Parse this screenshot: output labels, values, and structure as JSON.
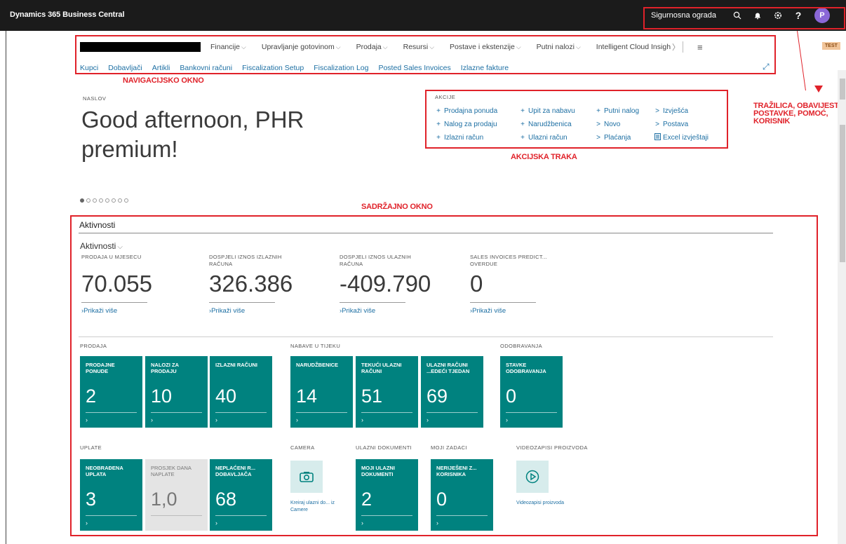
{
  "topbar": {
    "app_title": "Dynamics 365 Business Central",
    "environment": "Sigurnosna ograda",
    "avatar_initial": "P"
  },
  "nav": {
    "menus": [
      {
        "label": "Financije"
      },
      {
        "label": "Upravljanje gotovinom"
      },
      {
        "label": "Prodaja"
      },
      {
        "label": "Resursi"
      },
      {
        "label": "Postave i ekstenzije"
      },
      {
        "label": "Putni nalozi"
      },
      {
        "label": "Intelligent Cloud Insigh"
      }
    ],
    "links": [
      "Kupci",
      "Dobavljači",
      "Artikli",
      "Bankovni računi",
      "Fiscalization Setup",
      "Fiscalization Log",
      "Posted Sales Invoices",
      "Izlazne fakture"
    ],
    "badge": "TEST"
  },
  "annotations": {
    "nav": "NAVIGACIJSKO OKNO",
    "actions": "AKCIJSKA TRAKA",
    "content": "SADRŽAJNO OKNO",
    "search": "TRAŽILICA, OBAVIJESTI, POSTAVKE, POMOĆ, KORISNIK"
  },
  "headline": {
    "kicker": "NASLOV",
    "text": "Good afternoon, PHR premium!"
  },
  "actions": {
    "title": "AKCIJE",
    "items": [
      {
        "icon": "+",
        "label": "Prodajna ponuda"
      },
      {
        "icon": "+",
        "label": "Upit za nabavu"
      },
      {
        "icon": "+",
        "label": "Putni nalog"
      },
      {
        "icon": ">",
        "label": "Izvješća"
      },
      {
        "icon": "+",
        "label": "Nalog za prodaju"
      },
      {
        "icon": "+",
        "label": "Narudžbenica"
      },
      {
        "icon": ">",
        "label": "Novo"
      },
      {
        "icon": ">",
        "label": "Postava"
      },
      {
        "icon": "+",
        "label": "Izlazni račun"
      },
      {
        "icon": "+",
        "label": "Ulazni račun"
      },
      {
        "icon": ">",
        "label": "Plaćanja"
      },
      {
        "icon": "excel",
        "label": "Excel izvještaji"
      }
    ]
  },
  "content": {
    "title": "Aktivnosti",
    "subtitle": "Aktivnosti",
    "kpis": [
      {
        "label": "PRODAJA U MJESECU",
        "value": "70.055",
        "link": "Prikaži više"
      },
      {
        "label": "DOSPJELI IZNOS IZLAZNIH RAČUNA",
        "value": "326.386",
        "link": "Prikaži više"
      },
      {
        "label": "DOSPJELI IZNOS ULAZNIH RAČUNA",
        "value": "-409.790",
        "link": "Prikaži više"
      },
      {
        "label": "SALES INVOICES PREDICT... OVERDUE",
        "value": "0",
        "link": "Prikaži više"
      }
    ],
    "groups": {
      "prodaja": "PRODAJA",
      "nabave": "NABAVE U TIJEKU",
      "odobravanja": "ODOBRAVANJA",
      "uplate": "UPLATE",
      "camera": "CAMERA",
      "ulazni": "ULAZNI DOKUMENTI",
      "zadaci": "MOJI ZADACI",
      "video": "VIDEOZAPISI PROIZVODA"
    },
    "tiles": [
      {
        "label": "PRODAJNE PONUDE",
        "value": "2"
      },
      {
        "label": "NALOZI ZA PRODAJU",
        "value": "10"
      },
      {
        "label": "IZLAZNI RAČUNI",
        "value": "40"
      },
      {
        "label": "NARUDŽBENICE",
        "value": "14"
      },
      {
        "label": "TEKUĆI ULAZNI RAČUNI",
        "value": "51"
      },
      {
        "label": "ULAZNI RAČUNI ...EDEĆI TJEDAN",
        "value": "69"
      },
      {
        "label": "STAVKE ODOBRAVANJA",
        "value": "0"
      },
      {
        "label": "NEOBRAĐENA UPLATA",
        "value": "3"
      },
      {
        "label": "PROSJEK DANA NAPLATE",
        "value": "1,0"
      },
      {
        "label": "NEPLAĆENI R... DOBAVLJAČA",
        "value": "68"
      },
      {
        "label": "MOJI ULAZNI DOKUMENTI",
        "value": "2"
      },
      {
        "label": "NERIJEŠENI Z... KORISNIKA",
        "value": "0"
      }
    ],
    "camera_link": "Kreiraj ulazni do... iz Camere",
    "video_link": "Videozapisi proizvoda"
  }
}
